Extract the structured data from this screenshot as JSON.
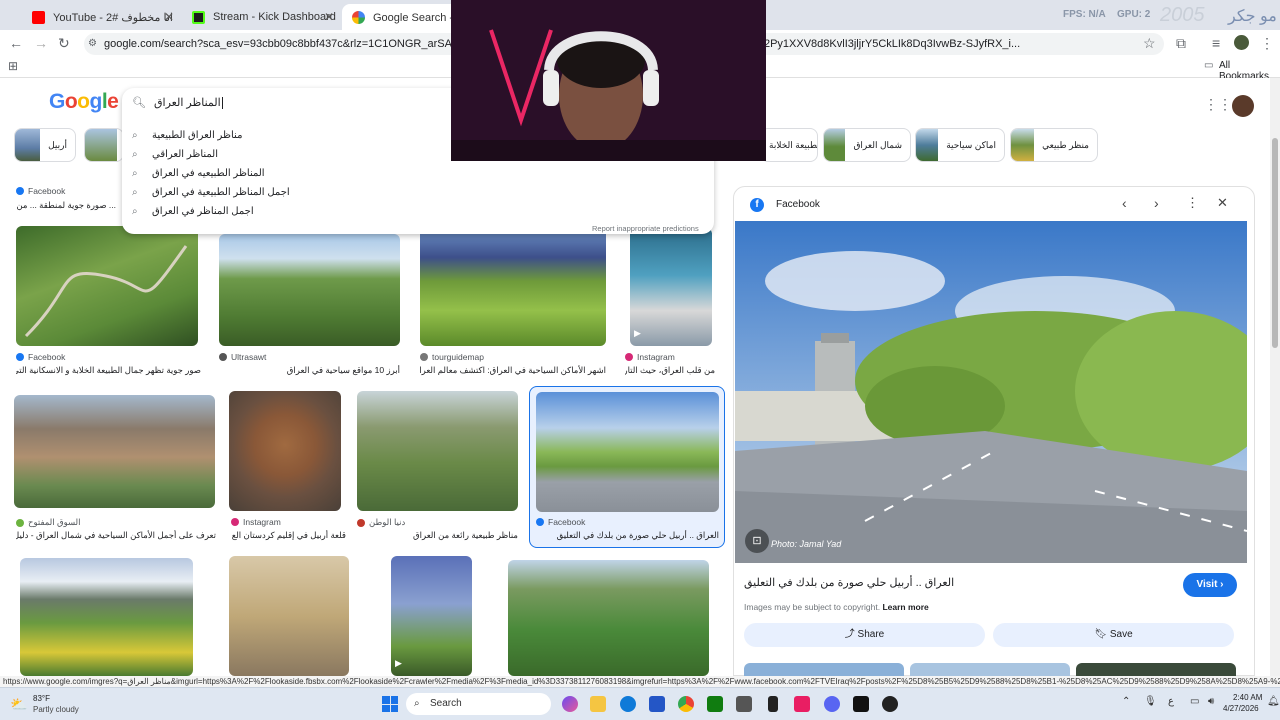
{
  "tabs": [
    {
      "label": "YouTube - انا مخطوف #2",
      "active": false
    },
    {
      "label": "Stream - Kick Dashboard",
      "active": false
    },
    {
      "label": "Google Search - مناظر العراق",
      "active": true
    }
  ],
  "overlay": {
    "fps": "FPS: N/A",
    "gpu": "GPU: 2",
    "watermark": "2005",
    "corner_text": "مو جكر"
  },
  "address": {
    "url": "google.com/search?sca_esv=93cbb09c8bbf437c&rlz=1C1ONGR_arSA1211&sxsrf=AE3TifO..._l-aN0CWEZBOHjofHoaMMDiKpaEWjvZ2Py1XXV8d8KvlI3jljrY5CkLIk8Dq3IvwBz-SJyfRX_i..."
  },
  "bookmarks": {
    "all_bookmarks": "All Bookmarks"
  },
  "search": {
    "logo": "Google",
    "query": "المناظر العراق",
    "suggestions": [
      "مناظر العراق الطبيعية",
      "المناظر العراقي",
      "المناظر الطبيعيه في العراق",
      "اجمل المناظر الطبيعية في العراق",
      "اجمل المناظر في العراق"
    ],
    "report": "Report inappropriate predictions"
  },
  "chips": [
    {
      "label": "أربيل",
      "color": "#5d7da6"
    },
    {
      "label": "",
      "color": "#6a8a40"
    },
    {
      "label": "الطبيعة الخلابة",
      "color": "#7da050"
    },
    {
      "label": "شمال العراق",
      "color": "#5e8a3a"
    },
    {
      "label": "اماكن سياحية",
      "color": "#4f7d9c"
    },
    {
      "label": "منظر طبيعي",
      "color": "#6f9140"
    }
  ],
  "results": [
    {
      "source": "Facebook",
      "caption": "... صورة جوية لمنطقة ... من محافظة دهوك في شمال ...",
      "icon": "#1877f2"
    },
    {
      "source": "Facebook",
      "caption": "صور جوية تظهر جمال الطبيعة الخلابة و الانسكانية التي ...",
      "icon": "#1877f2"
    },
    {
      "source": "Ultrasawt",
      "caption": "أبرز 10 مواقع سياحية في العراق",
      "icon": "#555"
    },
    {
      "source": "tourguidemap",
      "caption": "اشهر الأماكن السياحية في العراق: اكتشف معالم العراق السي...",
      "icon": "#777"
    },
    {
      "source": "Instagram",
      "caption": "من قلب العراق، حيث التاري...",
      "icon": "#d62976"
    },
    {
      "source": "السوق المفتوح",
      "caption": "تعرف على أجمل الأماكن السياحية في شمال العراق - دليل الأما...",
      "icon": "#6cb33f"
    },
    {
      "source": "Instagram",
      "caption": "قلعة أربيل في إقليم كردستان الع...",
      "icon": "#d62976"
    },
    {
      "source": "دنيا الوطن",
      "caption": "مناظر طبيعية رائعة من العراق",
      "icon": "#c0392b"
    },
    {
      "source": "Facebook",
      "caption": "العراق .. أربيل حلي صورة من بلدك في التعليق",
      "icon": "#1877f2"
    }
  ],
  "panel": {
    "source": "Facebook",
    "title": "العراق .. أربيل حلي صورة من بلدك في التعليق",
    "visit": "Visit",
    "copyright": "Images may be subject to copyright.",
    "learn_more": "Learn more",
    "share": "Share",
    "save": "Save",
    "photo_credit": "Photo: Jamal Yad"
  },
  "status_url": "https://www.google.com/imgres?q=مناظر العراق&imgurl=https%3A%2F%2Flookaside.fbsbx.com%2Flookaside%2Fcrawler%2Fmedia%2F%3Fmedia_id%3D3373811276083198&imgrefurl=https%3A%2F%2Fwww.facebook.com%2FTVEIraq%2Fposts%2F%25D8%25B5%25D9%2588%25D8%25B1-%25D8%25AC%25D9%2588%25D9%258A%25D8%25A9-%25...",
  "taskbar": {
    "weather_temp": "83°F",
    "weather_desc": "Partly cloudy",
    "search": "Search",
    "time": "2:40 AM",
    "date": "4/27/2026"
  }
}
